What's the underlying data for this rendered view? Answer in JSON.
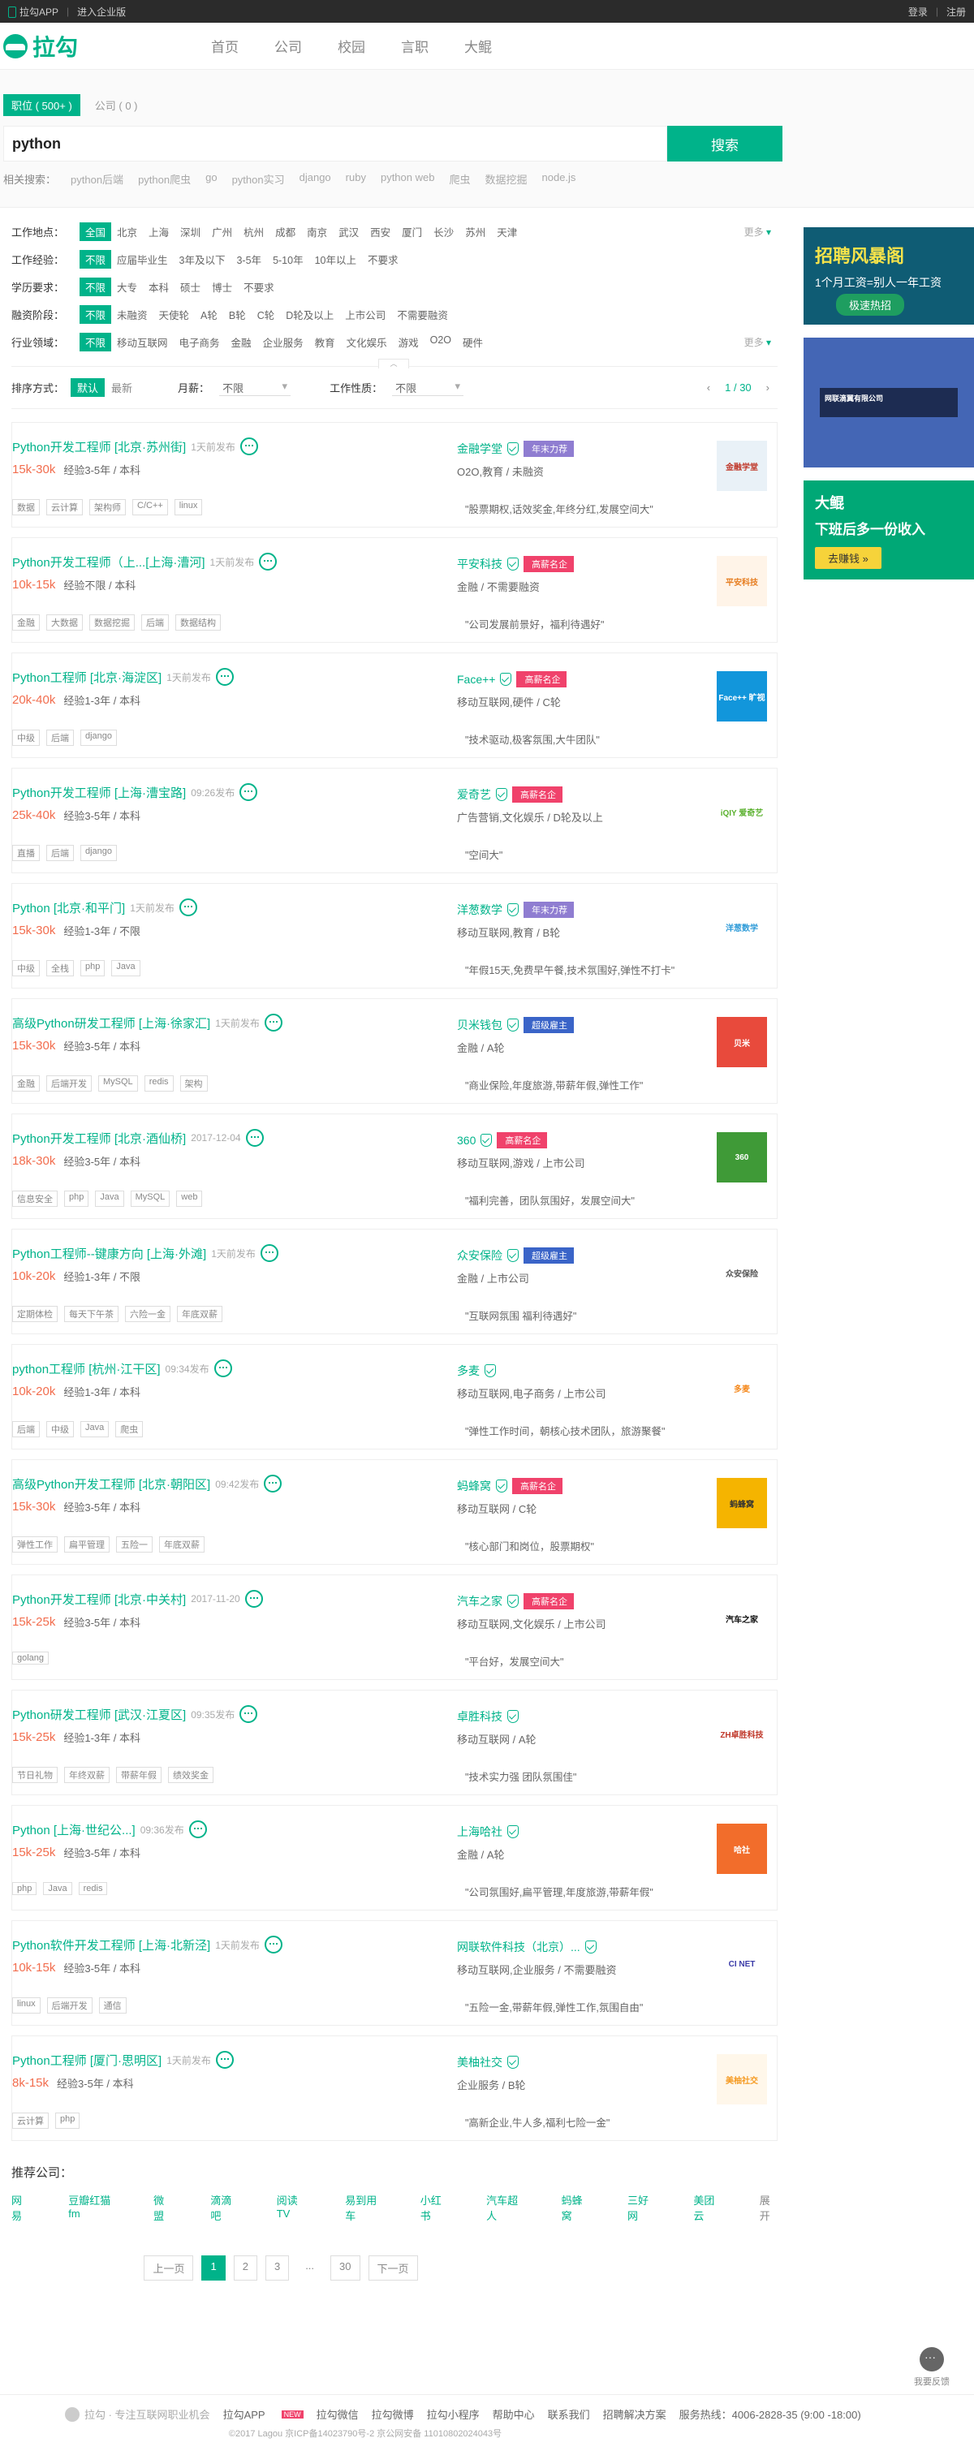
{
  "topbar": {
    "app": "拉勾APP",
    "enterprise": "进入企业版",
    "login": "登录",
    "register": "注册"
  },
  "logo": {
    "text": "拉勾"
  },
  "nav": [
    "首页",
    "公司",
    "校园",
    "言职",
    "大鲲"
  ],
  "search": {
    "tab_jobs": "职位 ( 500+ )",
    "tab_company": "公司 ( 0 )",
    "value": "python",
    "button": "搜索",
    "related_label": "相关搜索：",
    "related": [
      "python后端",
      "python爬虫",
      "go",
      "python实习",
      "django",
      "ruby",
      "python web",
      "爬虫",
      "数据挖掘",
      "node.js"
    ]
  },
  "filters": [
    {
      "label": "工作地点：",
      "options": [
        "全国",
        "北京",
        "上海",
        "深圳",
        "广州",
        "杭州",
        "成都",
        "南京",
        "武汉",
        "西安",
        "厦门",
        "长沙",
        "苏州",
        "天津"
      ],
      "selected": 0,
      "more": "更多"
    },
    {
      "label": "工作经验：",
      "options": [
        "不限",
        "应届毕业生",
        "3年及以下",
        "3-5年",
        "5-10年",
        "10年以上",
        "不要求"
      ],
      "selected": 0,
      "more": ""
    },
    {
      "label": "学历要求：",
      "options": [
        "不限",
        "大专",
        "本科",
        "硕士",
        "博士",
        "不要求"
      ],
      "selected": 0,
      "more": ""
    },
    {
      "label": "融资阶段：",
      "options": [
        "不限",
        "未融资",
        "天使轮",
        "A轮",
        "B轮",
        "C轮",
        "D轮及以上",
        "上市公司",
        "不需要融资"
      ],
      "selected": 0,
      "more": ""
    },
    {
      "label": "行业领域：",
      "options": [
        "不限",
        "移动互联网",
        "电子商务",
        "金融",
        "企业服务",
        "教育",
        "文化娱乐",
        "游戏",
        "O2O",
        "硬件"
      ],
      "selected": 0,
      "more": "更多"
    }
  ],
  "sort": {
    "label": "排序方式：",
    "default": "默认",
    "latest": "最新",
    "salary_label": "月薪：",
    "salary_value": "不限",
    "nature_label": "工作性质：",
    "nature_value": "不限",
    "page_info": "1 / 30"
  },
  "jobs": [
    {
      "title": "Python开发工程师 [北京·苏州街]",
      "time": "1天前发布",
      "salary": "15k-30k",
      "req": "经验3-5年 / 本科",
      "tags": [
        "数据",
        "云计算",
        "架构师",
        "C/C++",
        "linux"
      ],
      "company": "金融学堂",
      "badge": "年末力荐",
      "badge_color": "purple",
      "industry": "O2O,教育 / 未融资",
      "desc": "\"股票期权,话效奖金,年终分红,发展空间大\"",
      "logo_text": "金融学堂",
      "logo_bg": "#e9f1f7",
      "logo_fg": "#c0392b"
    },
    {
      "title": "Python开发工程师（上...[上海·漕河]",
      "time": "1天前发布",
      "salary": "10k-15k",
      "req": "经验不限 / 本科",
      "tags": [
        "金融",
        "大数据",
        "数据挖掘",
        "后端",
        "数据结构"
      ],
      "company": "平安科技",
      "badge": "高薪名企",
      "badge_color": "red",
      "industry": "金融 / 不需要融资",
      "desc": "\"公司发展前景好，福利待遇好\"",
      "logo_text": "平安科技",
      "logo_bg": "#fff4e8",
      "logo_fg": "#e67e22"
    },
    {
      "title": "Python工程师 [北京·海淀区]",
      "time": "1天前发布",
      "salary": "20k-40k",
      "req": "经验1-3年 / 本科",
      "tags": [
        "中级",
        "后端",
        "django"
      ],
      "company": "Face++",
      "badge": "高薪名企",
      "badge_color": "red",
      "industry": "移动互联网,硬件 / C轮",
      "desc": "\"技术驱动,极客氛围,大牛团队\"",
      "logo_text": "Face++ 旷视",
      "logo_bg": "#1296db",
      "logo_fg": "#fff"
    },
    {
      "title": "Python开发工程师 [上海·漕宝路]",
      "time": "09:26发布",
      "salary": "25k-40k",
      "req": "经验3-5年 / 本科",
      "tags": [
        "直播",
        "后端",
        "django"
      ],
      "company": "爱奇艺",
      "badge": "高薪名企",
      "badge_color": "red",
      "industry": "广告营销,文化娱乐 / D轮及以上",
      "desc": "\"空间大\"",
      "logo_text": "iQIY 爱奇艺",
      "logo_bg": "#fff",
      "logo_fg": "#5bb12f"
    },
    {
      "title": "Python [北京·和平门]",
      "time": "1天前发布",
      "salary": "15k-30k",
      "req": "经验1-3年 / 不限",
      "tags": [
        "中级",
        "全栈",
        "php",
        "Java"
      ],
      "company": "洋葱数学",
      "badge": "年末力荐",
      "badge_color": "purple",
      "industry": "移动互联网,教育 / B轮",
      "desc": "\"年假15天,免费早午餐,技术氛围好,弹性不打卡\"",
      "logo_text": "洋葱数学",
      "logo_bg": "#fff",
      "logo_fg": "#2e9bd8"
    },
    {
      "title": "高级Python研发工程师 [上海·徐家汇]",
      "time": "1天前发布",
      "salary": "15k-30k",
      "req": "经验3-5年 / 本科",
      "tags": [
        "金融",
        "后端开发",
        "MySQL",
        "redis",
        "架构"
      ],
      "company": "贝米钱包",
      "badge": "超级雇主",
      "badge_color": "blue",
      "industry": "金融 / A轮",
      "desc": "\"商业保险,年度旅游,带薪年假,弹性工作\"",
      "logo_text": "贝米",
      "logo_bg": "#e84a3c",
      "logo_fg": "#fff"
    },
    {
      "title": "Python开发工程师 [北京·酒仙桥]",
      "time": "2017-12-04",
      "salary": "18k-30k",
      "req": "经验3-5年 / 本科",
      "tags": [
        "信息安全",
        "php",
        "Java",
        "MySQL",
        "web"
      ],
      "company": "360",
      "badge": "高薪名企",
      "badge_color": "red",
      "industry": "移动互联网,游戏 / 上市公司",
      "desc": "\"福利完善，团队氛围好，发展空间大\"",
      "logo_text": "360",
      "logo_bg": "#3f9a37",
      "logo_fg": "#fff"
    },
    {
      "title": "Python工程师--键康方向 [上海·外滩]",
      "time": "1天前发布",
      "salary": "10k-20k",
      "req": "经验1-3年 / 不限",
      "tags": [
        "定期体检",
        "每天下午茶",
        "六险一金",
        "年底双薪"
      ],
      "company": "众安保险",
      "badge": "超级雇主",
      "badge_color": "blue",
      "industry": "金融 / 上市公司",
      "desc": "\"互联网氛围 福利待遇好\"",
      "logo_text": "众安保险",
      "logo_bg": "#fff",
      "logo_fg": "#555"
    },
    {
      "title": "python工程师 [杭州·江干区]",
      "time": "09:34发布",
      "salary": "10k-20k",
      "req": "经验1-3年 / 本科",
      "tags": [
        "后端",
        "中级",
        "Java",
        "爬虫"
      ],
      "company": "多麦",
      "badge": "",
      "badge_color": "",
      "industry": "移动互联网,电子商务 / 上市公司",
      "desc": "\"弹性工作时间，朝核心技术团队，旅游聚餐\"",
      "logo_text": "多麦",
      "logo_bg": "#fff",
      "logo_fg": "#f58a1f"
    },
    {
      "title": "高级Python开发工程师 [北京·朝阳区]",
      "time": "09:42发布",
      "salary": "15k-30k",
      "req": "经验3-5年 / 本科",
      "tags": [
        "弹性工作",
        "扁平管理",
        "五险一",
        "年底双薪"
      ],
      "company": "蚂蜂窝",
      "badge": "高薪名企",
      "badge_color": "red",
      "industry": "移动互联网 / C轮",
      "desc": "\"核心部门和岗位，股票期权\"",
      "logo_text": "蚂蜂窝",
      "logo_bg": "#f5b400",
      "logo_fg": "#333"
    },
    {
      "title": "Python开发工程师 [北京·中关村]",
      "time": "2017-11-20",
      "salary": "15k-25k",
      "req": "经验3-5年 / 本科",
      "tags": [
        "golang"
      ],
      "company": "汽车之家",
      "badge": "高薪名企",
      "badge_color": "red",
      "industry": "移动互联网,文化娱乐 / 上市公司",
      "desc": "\"平台好，发展空间大\"",
      "logo_text": "汽车之家",
      "logo_bg": "#fff",
      "logo_fg": "#111"
    },
    {
      "title": "Python研发工程师 [武汉·江夏区]",
      "time": "09:35发布",
      "salary": "15k-25k",
      "req": "经验1-3年 / 本科",
      "tags": [
        "节日礼物",
        "年终双薪",
        "带薪年假",
        "绩效奖金"
      ],
      "company": "卓胜科技",
      "badge": "",
      "badge_color": "",
      "industry": "移动互联网 / A轮",
      "desc": "\"技术实力强 团队氛围佳\"",
      "logo_text": "ZH卓胜科技",
      "logo_bg": "#fff",
      "logo_fg": "#c0392b"
    },
    {
      "title": "Python [上海·世纪公...]",
      "time": "09:36发布",
      "salary": "15k-25k",
      "req": "经验3-5年 / 本科",
      "tags": [
        "php",
        "Java",
        "redis"
      ],
      "company": "上海哈社",
      "badge": "",
      "badge_color": "",
      "industry": "金融 / A轮",
      "desc": "\"公司氛围好,扁平管理,年度旅游,带薪年假\"",
      "logo_text": "哈社",
      "logo_bg": "#f26d2b",
      "logo_fg": "#fff"
    },
    {
      "title": "Python软件开发工程师 [上海·北新泾]",
      "time": "1天前发布",
      "salary": "10k-15k",
      "req": "经验3-5年 / 本科",
      "tags": [
        "linux",
        "后端开发",
        "通信"
      ],
      "company": "网联软件科技（北京）...",
      "badge": "",
      "badge_color": "",
      "industry": "移动互联网,企业服务 / 不需要融资",
      "desc": "\"五险一金,带薪年假,弹性工作,氛围自由\"",
      "logo_text": "CI NET",
      "logo_bg": "#fff",
      "logo_fg": "#3b3ba8"
    },
    {
      "title": "Python工程师 [厦门·思明区]",
      "time": "1天前发布",
      "salary": "8k-15k",
      "req": "经验3-5年 / 本科",
      "tags": [
        "云计算",
        "php"
      ],
      "company": "美柚社交",
      "badge": "",
      "badge_color": "",
      "industry": "企业服务 / B轮",
      "desc": "\"高新企业,牛人多,福利七险一金\"",
      "logo_text": "美柚社交",
      "logo_bg": "#fff7ea",
      "logo_fg": "#f59b23"
    }
  ],
  "ads": [
    {
      "title": "招聘风暴阁",
      "sub": "1个月工资=别人一年工资",
      "btn": "极速热招"
    },
    {
      "title": "网联滴翼有限公司",
      "sub": ""
    },
    {
      "title": "大鲲",
      "sub": "下班后多一份收入",
      "btn": "去赚钱 »"
    }
  ],
  "recommend": {
    "title": "推荐公司：",
    "companies": [
      "网易",
      "豆瓣红猫fm",
      "微盟",
      "滴滴吧",
      "阅读TV",
      "易到用车",
      "小红书",
      "汽车超人",
      "蚂蜂窝",
      "三好网",
      "美团云"
    ],
    "more": "展开"
  },
  "pagination": {
    "prev": "上一页",
    "pages": [
      "1",
      "2",
      "3"
    ],
    "dots": "...",
    "last": "30",
    "next": "下一页"
  },
  "feedback": {
    "label": "我要反馈"
  },
  "footer": {
    "slogan": "拉勾 · 专注互联网职业机会",
    "links": [
      "拉勾APP",
      "拉勾微信",
      "拉勾微博",
      "拉勾小程序",
      "帮助中心",
      "联系我们",
      "招聘解决方案",
      "服务热线：4006-2828-35 (9:00 -18:00)"
    ],
    "new": "NEW",
    "copyright": "©2017 Lagou 京ICP备14023790号-2 京公网安备 11010802024043号"
  }
}
